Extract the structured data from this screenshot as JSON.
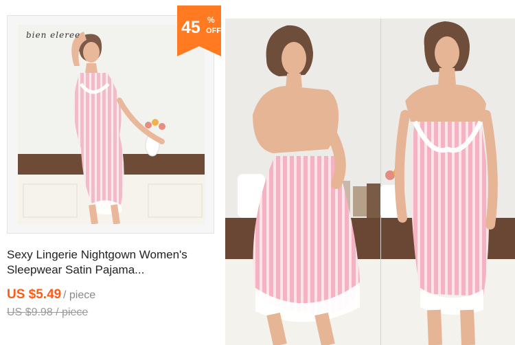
{
  "product": {
    "brand_logo": "bien eleree",
    "discount": {
      "value": "45",
      "percent": "%",
      "off": "OFF"
    },
    "title_line1": "Sexy Lingerie Nightgown Women's",
    "title_line2": "Sleepwear Satin Pajama...",
    "price": "US $5.49",
    "unit": "/ piece",
    "original_price": "US $9.98 / piece"
  },
  "colors": {
    "accent": "#ff7a21",
    "price": "#ff5a16",
    "dress": "#f4b6c6",
    "stripe": "#ffffff"
  }
}
